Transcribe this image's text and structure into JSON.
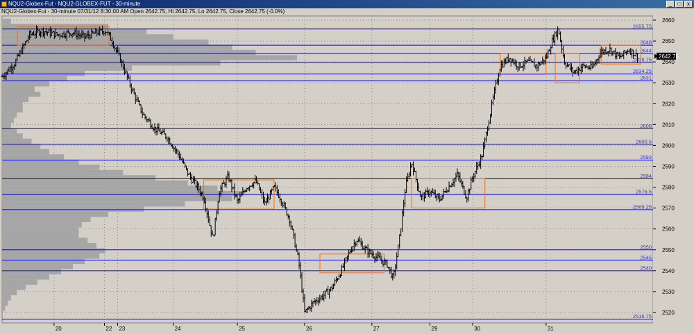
{
  "window": {
    "title": "NQU2-Globex-Fut - NQU2-GLOBEX-FUT - 30-minute",
    "info": "NQU2-Globex-Fut - 30-minute 07/31/12 8:30:00 AM Open 2642.75, Hi 2642.75, Lo 2642.75, Close 2642.75 (-0.0%)",
    "buttons": [
      "_",
      "□",
      "x"
    ]
  },
  "chart_data": {
    "type": "ohlc-bar",
    "title": "NQU2-Globex-Fut - 30-minute",
    "ylim": [
      2515,
      2662
    ],
    "y_ticks": [
      2520,
      2530,
      2540,
      2550,
      2560,
      2570,
      2580,
      2590,
      2600,
      2610,
      2620,
      2630,
      2640,
      2650,
      2660
    ],
    "x_tick_labels": [
      "20",
      "22",
      "23",
      "24",
      "25",
      "26",
      "27",
      "29",
      "30",
      "31"
    ],
    "last_price": "2642.75",
    "levels": [
      {
        "value": 2655.75,
        "label": "2655.75"
      },
      {
        "value": 2648,
        "label": "2648"
      },
      {
        "value": 2644,
        "label": "2644"
      },
      {
        "value": 2639.75,
        "label": "2639.75"
      },
      {
        "value": 2634.25,
        "label": "2634.25"
      },
      {
        "value": 2631,
        "label": "2631"
      },
      {
        "value": 2608,
        "label": "2608"
      },
      {
        "value": 2600.5,
        "label": "2600.5"
      },
      {
        "value": 2593,
        "label": "2593"
      },
      {
        "value": 2584,
        "label": "2584"
      },
      {
        "value": 2576.5,
        "label": "2576.5"
      },
      {
        "value": 2569.25,
        "label": "2569.25"
      },
      {
        "value": 2550,
        "label": "2550"
      },
      {
        "value": 2545,
        "label": "2545"
      },
      {
        "value": 2540,
        "label": "2540"
      },
      {
        "value": 2516.75,
        "label": "2516.75"
      }
    ],
    "value_area_boxes": [
      {
        "x_start": 0.5,
        "x_end": 3.5,
        "low": 2648,
        "high": 2657
      },
      {
        "x_start": 6.6,
        "x_end": 8.9,
        "low": 2569.5,
        "high": 2583.5
      },
      {
        "x_start": 10.4,
        "x_end": 12.5,
        "low": 2539,
        "high": 2548
      },
      {
        "x_start": 13.4,
        "x_end": 15.8,
        "low": 2570,
        "high": 2584
      },
      {
        "x_start": 16.3,
        "x_end": 17.8,
        "low": 2634,
        "high": 2644
      },
      {
        "x_start": 18.1,
        "x_end": 18.9,
        "low": 2630,
        "high": 2644
      },
      {
        "x_start": 19.6,
        "x_end": 20.9,
        "low": 2639,
        "high": 2648
      }
    ],
    "price_path": [
      [
        0.0,
        2633
      ],
      [
        0.4,
        2639
      ],
      [
        0.9,
        2653
      ],
      [
        1.3,
        2655
      ],
      [
        1.8,
        2653
      ],
      [
        2.3,
        2654
      ],
      [
        2.7,
        2652
      ],
      [
        3.1,
        2654
      ],
      [
        3.4,
        2655
      ],
      [
        3.6,
        2650
      ],
      [
        3.9,
        2640
      ],
      [
        4.3,
        2625
      ],
      [
        4.6,
        2615
      ],
      [
        5.0,
        2608
      ],
      [
        5.4,
        2604
      ],
      [
        5.8,
        2595
      ],
      [
        6.1,
        2586
      ],
      [
        6.4,
        2580
      ],
      [
        6.6,
        2575
      ],
      [
        6.9,
        2555
      ],
      [
        7.1,
        2578
      ],
      [
        7.4,
        2585
      ],
      [
        7.7,
        2573
      ],
      [
        8.0,
        2580
      ],
      [
        8.3,
        2583
      ],
      [
        8.6,
        2572
      ],
      [
        8.9,
        2580
      ],
      [
        9.1,
        2575
      ],
      [
        9.4,
        2565
      ],
      [
        9.7,
        2545
      ],
      [
        9.9,
        2520
      ],
      [
        10.2,
        2525
      ],
      [
        10.5,
        2528
      ],
      [
        10.8,
        2532
      ],
      [
        11.1,
        2540
      ],
      [
        11.4,
        2550
      ],
      [
        11.6,
        2555
      ],
      [
        11.9,
        2550
      ],
      [
        12.1,
        2548
      ],
      [
        12.4,
        2545
      ],
      [
        12.6,
        2543
      ],
      [
        12.8,
        2536
      ],
      [
        13.0,
        2555
      ],
      [
        13.2,
        2580
      ],
      [
        13.4,
        2592
      ],
      [
        13.7,
        2575
      ],
      [
        14.0,
        2578
      ],
      [
        14.3,
        2574
      ],
      [
        14.6,
        2580
      ],
      [
        14.9,
        2586
      ],
      [
        15.2,
        2575
      ],
      [
        15.4,
        2585
      ],
      [
        15.7,
        2595
      ],
      [
        15.9,
        2610
      ],
      [
        16.1,
        2625
      ],
      [
        16.3,
        2638
      ],
      [
        16.6,
        2642
      ],
      [
        16.9,
        2638
      ],
      [
        17.2,
        2640
      ],
      [
        17.5,
        2638
      ],
      [
        17.8,
        2642
      ],
      [
        18.0,
        2650
      ],
      [
        18.2,
        2656
      ],
      [
        18.4,
        2640
      ],
      [
        18.7,
        2635
      ],
      [
        19.0,
        2638
      ],
      [
        19.3,
        2637
      ],
      [
        19.6,
        2645
      ],
      [
        19.9,
        2646
      ],
      [
        20.2,
        2642
      ],
      [
        20.5,
        2646
      ],
      [
        20.8,
        2642.75
      ]
    ],
    "volume_profile": [
      {
        "price": 2659.5,
        "v": 0.03
      },
      {
        "price": 2657,
        "v": 0.36
      },
      {
        "price": 2654.5,
        "v": 0.49
      },
      {
        "price": 2652,
        "v": 0.58
      },
      {
        "price": 2649.5,
        "v": 0.7
      },
      {
        "price": 2647,
        "v": 0.78
      },
      {
        "price": 2644.5,
        "v": 0.86
      },
      {
        "price": 2642,
        "v": 1.0
      },
      {
        "price": 2639.5,
        "v": 0.74
      },
      {
        "price": 2637,
        "v": 0.44
      },
      {
        "price": 2634.5,
        "v": 0.28
      },
      {
        "price": 2632,
        "v": 0.22
      },
      {
        "price": 2629.5,
        "v": 0.16
      },
      {
        "price": 2627,
        "v": 0.11
      },
      {
        "price": 2624.5,
        "v": 0.13
      },
      {
        "price": 2622,
        "v": 0.09
      },
      {
        "price": 2619.5,
        "v": 0.07
      },
      {
        "price": 2617,
        "v": 0.07
      },
      {
        "price": 2614.5,
        "v": 0.05
      },
      {
        "price": 2612,
        "v": 0.04
      },
      {
        "price": 2609.5,
        "v": 0.03
      },
      {
        "price": 2607,
        "v": 0.05
      },
      {
        "price": 2604.5,
        "v": 0.07
      },
      {
        "price": 2602,
        "v": 0.1
      },
      {
        "price": 2599.5,
        "v": 0.13
      },
      {
        "price": 2597,
        "v": 0.16
      },
      {
        "price": 2594.5,
        "v": 0.21
      },
      {
        "price": 2592,
        "v": 0.26
      },
      {
        "price": 2589.5,
        "v": 0.33
      },
      {
        "price": 2587,
        "v": 0.41
      },
      {
        "price": 2584.5,
        "v": 0.52
      },
      {
        "price": 2582,
        "v": 0.63
      },
      {
        "price": 2579.5,
        "v": 0.73
      },
      {
        "price": 2577,
        "v": 0.82
      },
      {
        "price": 2574.5,
        "v": 0.78
      },
      {
        "price": 2572,
        "v": 0.62
      },
      {
        "price": 2569.5,
        "v": 0.48
      },
      {
        "price": 2567,
        "v": 0.36
      },
      {
        "price": 2564.5,
        "v": 0.3
      },
      {
        "price": 2562,
        "v": 0.27
      },
      {
        "price": 2559.5,
        "v": 0.26
      },
      {
        "price": 2557,
        "v": 0.26
      },
      {
        "price": 2554.5,
        "v": 0.29
      },
      {
        "price": 2552,
        "v": 0.32
      },
      {
        "price": 2549.5,
        "v": 0.35
      },
      {
        "price": 2547,
        "v": 0.33
      },
      {
        "price": 2544.5,
        "v": 0.28
      },
      {
        "price": 2542,
        "v": 0.24
      },
      {
        "price": 2539.5,
        "v": 0.2
      },
      {
        "price": 2537,
        "v": 0.16
      },
      {
        "price": 2534.5,
        "v": 0.12
      },
      {
        "price": 2532,
        "v": 0.08
      },
      {
        "price": 2529.5,
        "v": 0.05
      },
      {
        "price": 2527,
        "v": 0.03
      },
      {
        "price": 2524.5,
        "v": 0.02
      },
      {
        "price": 2522,
        "v": 0.01
      }
    ],
    "grid": true,
    "colors": {
      "plot_bg": "#d4d0c8",
      "frame_bg": "#d4d0c8",
      "bars": "#000000",
      "levels": "#0000ff",
      "level_labels": "#3333ff",
      "boxes": "#ff6a00",
      "profile": "#a6a6a6",
      "grid": "#6e6e6e",
      "last_price_bg": "#000000"
    }
  }
}
